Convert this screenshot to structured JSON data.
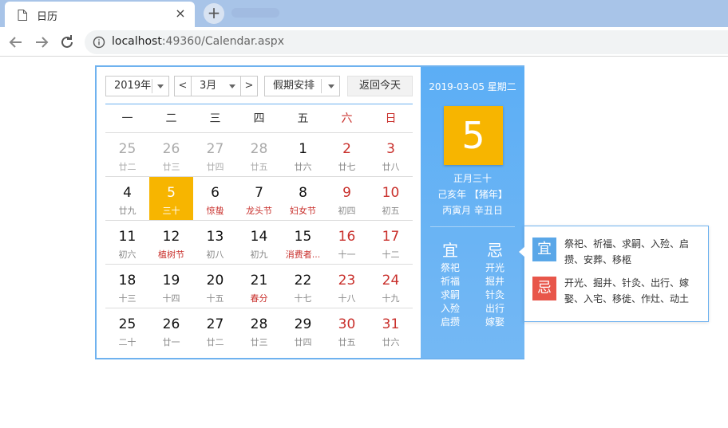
{
  "browser": {
    "tab_title": "日历",
    "tab_close": "×",
    "new_tab": "+",
    "url_host": "localhost",
    "url_rest": ":49360/Calendar.aspx"
  },
  "controls": {
    "year": "2019年",
    "prev": "<",
    "month": "3月",
    "next": ">",
    "holiday": "假期安排",
    "today": "返回今天"
  },
  "weekdays": [
    "一",
    "二",
    "三",
    "四",
    "五",
    "六",
    "日"
  ],
  "weeks": [
    [
      {
        "d": "25",
        "l": "廿二",
        "other": true
      },
      {
        "d": "26",
        "l": "廿三",
        "other": true
      },
      {
        "d": "27",
        "l": "廿四",
        "other": true
      },
      {
        "d": "28",
        "l": "廿五",
        "other": true
      },
      {
        "d": "1",
        "l": "廿六"
      },
      {
        "d": "2",
        "l": "廿七",
        "wkend": true
      },
      {
        "d": "3",
        "l": "廿八",
        "wkend": true
      }
    ],
    [
      {
        "d": "4",
        "l": "廿九"
      },
      {
        "d": "5",
        "l": "三十",
        "sel": true
      },
      {
        "d": "6",
        "l": "惊蛰",
        "fest": true
      },
      {
        "d": "7",
        "l": "龙头节",
        "fest": true
      },
      {
        "d": "8",
        "l": "妇女节",
        "fest": true
      },
      {
        "d": "9",
        "l": "初四",
        "wkend": true
      },
      {
        "d": "10",
        "l": "初五",
        "wkend": true
      }
    ],
    [
      {
        "d": "11",
        "l": "初六"
      },
      {
        "d": "12",
        "l": "植树节",
        "fest": true
      },
      {
        "d": "13",
        "l": "初八"
      },
      {
        "d": "14",
        "l": "初九"
      },
      {
        "d": "15",
        "l": "消费者...",
        "fest": true
      },
      {
        "d": "16",
        "l": "十一",
        "wkend": true
      },
      {
        "d": "17",
        "l": "十二",
        "wkend": true
      }
    ],
    [
      {
        "d": "18",
        "l": "十三"
      },
      {
        "d": "19",
        "l": "十四"
      },
      {
        "d": "20",
        "l": "十五"
      },
      {
        "d": "21",
        "l": "春分",
        "fest": true
      },
      {
        "d": "22",
        "l": "十七"
      },
      {
        "d": "23",
        "l": "十八",
        "wkend": true
      },
      {
        "d": "24",
        "l": "十九",
        "wkend": true
      }
    ],
    [
      {
        "d": "25",
        "l": "二十"
      },
      {
        "d": "26",
        "l": "廿一"
      },
      {
        "d": "27",
        "l": "廿二"
      },
      {
        "d": "28",
        "l": "廿三"
      },
      {
        "d": "29",
        "l": "廿四"
      },
      {
        "d": "30",
        "l": "廿五",
        "wkend": true
      },
      {
        "d": "31",
        "l": "廿六",
        "wkend": true
      }
    ]
  ],
  "detail": {
    "date": "2019-03-05 星期二",
    "day": "5",
    "lunar": "正月三十",
    "ganzhi_year": "己亥年 【猪年】",
    "ganzhi_month_day": "丙寅月 辛丑日",
    "yi_title": "宜",
    "ji_title": "忌",
    "yi_items": [
      "祭祀",
      "祈福",
      "求嗣",
      "入殓",
      "启攒"
    ],
    "ji_items": [
      "开光",
      "掘井",
      "针灸",
      "出行",
      "嫁娶"
    ]
  },
  "tooltip": {
    "yi_badge": "宜",
    "yi_text": "祭祀、祈福、求嗣、入殓、启攒、安葬、移柩",
    "ji_badge": "忌",
    "ji_text": "开光、掘井、针灸、出行、嫁娶、入宅、移徙、作灶、动土"
  },
  "colors": {
    "accent_blue": "#6fb2ef",
    "selected_gold": "#f7b500",
    "weekend_red": "#c9302c",
    "yi_badge": "#5aa7e8",
    "ji_badge": "#e8564a"
  },
  "icons": {
    "tab": "document-icon",
    "back": "arrow-left-icon",
    "forward": "arrow-right-icon",
    "reload": "reload-icon",
    "site_info": "info-icon"
  }
}
